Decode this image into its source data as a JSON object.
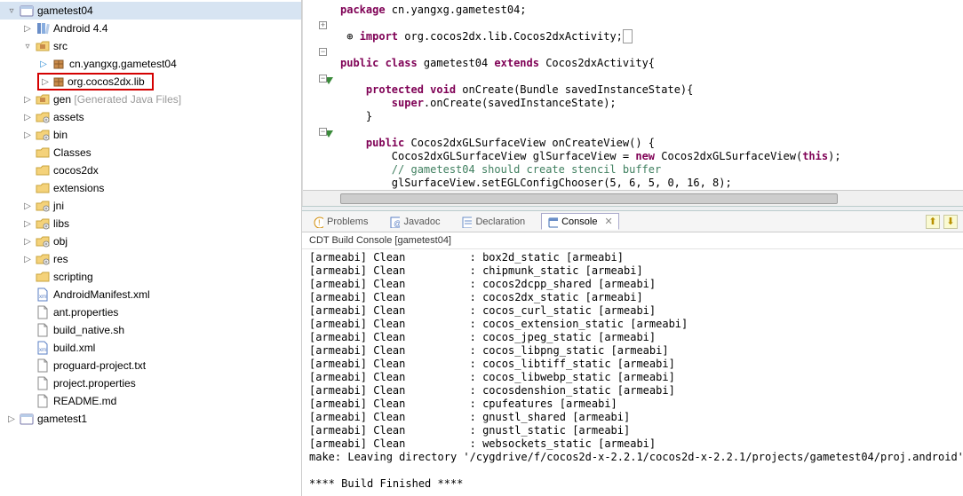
{
  "tree": {
    "root_project": "gametest04",
    "items": [
      {
        "depth": 1,
        "tw": "▷",
        "ico": "lib",
        "label": "Android 4.4"
      },
      {
        "depth": 1,
        "tw": "▿",
        "ico": "srcfold",
        "label": "src"
      },
      {
        "depth": 2,
        "tw": "▷",
        "ico": "pkg",
        "label": "cn.yangxg.gametest04",
        "tw_color": "#2a8ad4"
      },
      {
        "depth": 2,
        "tw": "▷",
        "ico": "pkg",
        "label": "org.cocos2dx.lib",
        "highlight": true
      },
      {
        "depth": 1,
        "tw": "▷",
        "ico": "srcfold",
        "label": "gen",
        "suffix": "[Generated Java Files]"
      },
      {
        "depth": 1,
        "tw": "▷",
        "ico": "foldg",
        "label": "assets"
      },
      {
        "depth": 1,
        "tw": "▷",
        "ico": "foldg",
        "label": "bin"
      },
      {
        "depth": 1,
        "tw": "",
        "ico": "fold",
        "label": "Classes"
      },
      {
        "depth": 1,
        "tw": "",
        "ico": "fold",
        "label": "cocos2dx"
      },
      {
        "depth": 1,
        "tw": "",
        "ico": "fold",
        "label": "extensions"
      },
      {
        "depth": 1,
        "tw": "▷",
        "ico": "foldg",
        "label": "jni"
      },
      {
        "depth": 1,
        "tw": "▷",
        "ico": "foldg",
        "label": "libs"
      },
      {
        "depth": 1,
        "tw": "▷",
        "ico": "foldg",
        "label": "obj"
      },
      {
        "depth": 1,
        "tw": "▷",
        "ico": "foldg",
        "label": "res"
      },
      {
        "depth": 1,
        "tw": "",
        "ico": "fold",
        "label": "scripting"
      },
      {
        "depth": 1,
        "tw": "",
        "ico": "xml",
        "label": "AndroidManifest.xml"
      },
      {
        "depth": 1,
        "tw": "",
        "ico": "file",
        "label": "ant.properties"
      },
      {
        "depth": 1,
        "tw": "",
        "ico": "file",
        "label": "build_native.sh"
      },
      {
        "depth": 1,
        "tw": "",
        "ico": "xml",
        "label": "build.xml"
      },
      {
        "depth": 1,
        "tw": "",
        "ico": "file",
        "label": "proguard-project.txt"
      },
      {
        "depth": 1,
        "tw": "",
        "ico": "file",
        "label": "project.properties"
      },
      {
        "depth": 1,
        "tw": "",
        "ico": "file",
        "label": "README.md"
      }
    ],
    "sibling_project": "gametest1"
  },
  "code": {
    "l1": "package",
    "l1b": " cn.yangxg.gametest04;",
    "l2a": "import",
    "l2b": " org.cocos2dx.lib.Cocos2dxActivity;",
    "l3a": "public class",
    "l3b": " gametest04 ",
    "l3c": "extends",
    "l3d": " Cocos2dxActivity{",
    "l4a": "protected void",
    "l4b": " onCreate(Bundle savedInstanceState){",
    "l5a": "super",
    "l5b": ".onCreate(savedInstanceState);",
    "l6": "    }",
    "l7a": "public",
    "l7b": " Cocos2dxGLSurfaceView onCreateView() {",
    "l8a": "        Cocos2dxGLSurfaceView glSurfaceView = ",
    "l8b": "new",
    "l8c": " Cocos2dxGLSurfaceView(",
    "l8d": "this",
    "l8e": ");",
    "l9": "        // gametest04 should create stencil buffer",
    "l10": "        glSurfaceView.setEGLConfigChooser(5, 6, 5, 0, 16, 8);"
  },
  "tabs": {
    "problems": "Problems",
    "javadoc": "Javadoc",
    "declaration": "Declaration",
    "console": "Console",
    "close": "✕"
  },
  "console_title": "CDT Build Console [gametest04]",
  "console_lines": [
    "[armeabi] Clean          : box2d_static [armeabi]",
    "[armeabi] Clean          : chipmunk_static [armeabi]",
    "[armeabi] Clean          : cocos2dcpp_shared [armeabi]",
    "[armeabi] Clean          : cocos2dx_static [armeabi]",
    "[armeabi] Clean          : cocos_curl_static [armeabi]",
    "[armeabi] Clean          : cocos_extension_static [armeabi]",
    "[armeabi] Clean          : cocos_jpeg_static [armeabi]",
    "[armeabi] Clean          : cocos_libpng_static [armeabi]",
    "[armeabi] Clean          : cocos_libtiff_static [armeabi]",
    "[armeabi] Clean          : cocos_libwebp_static [armeabi]",
    "[armeabi] Clean          : cocosdenshion_static [armeabi]",
    "[armeabi] Clean          : cpufeatures [armeabi]",
    "[armeabi] Clean          : gnustl_shared [armeabi]",
    "[armeabi] Clean          : gnustl_static [armeabi]",
    "[armeabi] Clean          : websockets_static [armeabi]",
    "make: Leaving directory '/cygdrive/f/cocos2d-x-2.2.1/cocos2d-x-2.2.1/projects/gametest04/proj.android'",
    "",
    "**** Build Finished ****"
  ]
}
